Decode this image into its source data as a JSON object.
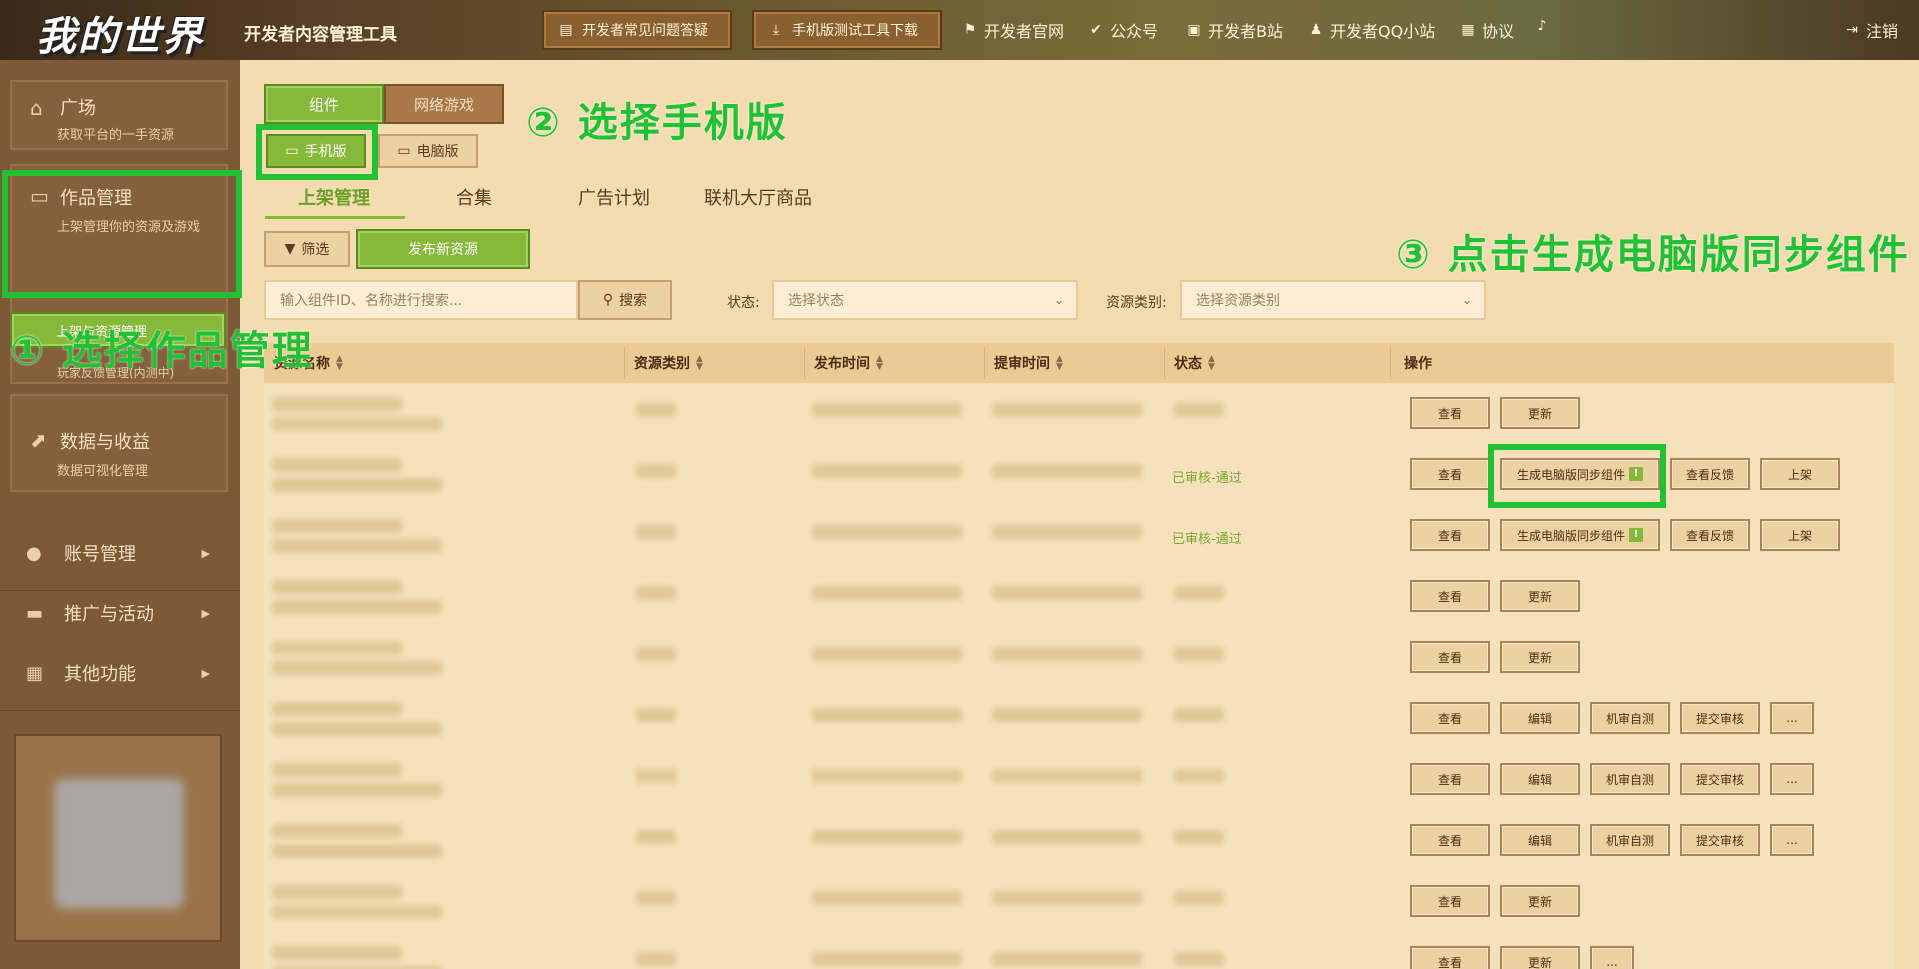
{
  "header": {
    "logo": "我的世界",
    "app_title": "开发者内容管理工具",
    "faq_button": "开发者常见问题答疑",
    "download_button": "手机版测试工具下载",
    "links": [
      "开发者官网",
      "公众号",
      "开发者B站",
      "开发者QQ小站",
      "协议"
    ],
    "logout": "注销"
  },
  "sidebar": {
    "square": {
      "title": "广场",
      "subtitle": "获取平台的一手资源"
    },
    "works": {
      "title": "作品管理",
      "subtitle": "上架管理你的资源及游戏",
      "active_item": "上架与资源管理",
      "extra_item": "玩家反馈管理(内测中)"
    },
    "data": {
      "title": "数据与收益",
      "subtitle": "数据可视化管理"
    },
    "nav": [
      "账号管理",
      "推广与活动",
      "其他功能"
    ]
  },
  "main": {
    "type_tabs": [
      "组件",
      "网络游戏"
    ],
    "platform_tabs": [
      "手机版",
      "电脑版"
    ],
    "sub_tabs": [
      "上架管理",
      "合集",
      "广告计划",
      "联机大厅商品"
    ],
    "filter_button": "筛选",
    "publish_button": "发布新资源",
    "search_placeholder": "输入组件ID、名称进行搜索...",
    "search_button": "搜索",
    "status_label": "状态:",
    "status_placeholder": "选择状态",
    "category_label": "资源类别:",
    "category_placeholder": "选择资源类别",
    "columns": [
      "资源名称",
      "资源类别",
      "发布时间",
      "提审时间",
      "状态",
      "操作"
    ],
    "status_approved": "已审核-通过",
    "actions": {
      "view": "查看",
      "update": "更新",
      "gen_pc": "生成电脑版同步组件",
      "view_feedback": "查看反馈",
      "list": "上架",
      "edit": "编辑",
      "machine_test": "机审自测",
      "submit_review": "提交审核",
      "more": "..."
    }
  },
  "annotations": {
    "step1": "① 选择作品管理",
    "step2": "② 选择手机版",
    "step3": "③ 点击生成电脑版同步组件"
  },
  "colors": {
    "highlight": "#22c033",
    "active": "#86b83a",
    "topbar": "#5a4026",
    "sidebar": "#7c5a38",
    "content": "#f3ddb0"
  }
}
